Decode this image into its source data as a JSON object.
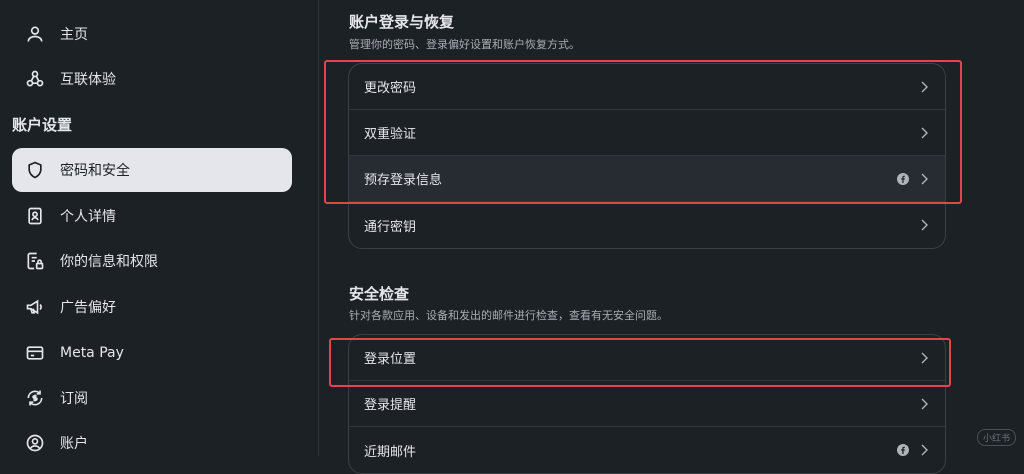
{
  "sidebar": {
    "items_top": [
      {
        "label": "主页"
      },
      {
        "label": "互联体验"
      }
    ],
    "section_heading": "账户设置",
    "items": [
      {
        "label": "密码和安全"
      },
      {
        "label": "个人详情"
      },
      {
        "label": "你的信息和权限"
      },
      {
        "label": "广告偏好"
      },
      {
        "label": "Meta Pay"
      },
      {
        "label": "订阅"
      },
      {
        "label": "账户"
      }
    ]
  },
  "main": {
    "login_group": {
      "title": "账户登录与恢复",
      "desc": "管理你的密码、登录偏好设置和账户恢复方式。",
      "rows": [
        {
          "label": "更改密码"
        },
        {
          "label": "双重验证"
        },
        {
          "label": "预存登录信息"
        },
        {
          "label": "通行密钥"
        }
      ]
    },
    "security_group": {
      "title": "安全检查",
      "desc": "针对各款应用、设备和发出的邮件进行检查，查看有无安全问题。",
      "rows": [
        {
          "label": "登录位置"
        },
        {
          "label": "登录提醒"
        },
        {
          "label": "近期邮件"
        }
      ]
    }
  },
  "watermark": "小红书",
  "colors": {
    "accent_highlight": "#e0464b",
    "active_bg": "#e4e6eb",
    "bg": "#1c2126"
  }
}
